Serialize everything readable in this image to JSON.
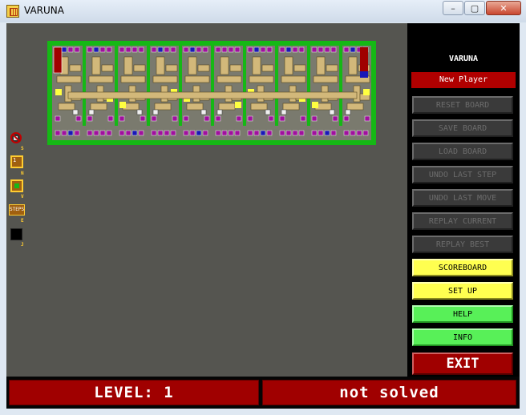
{
  "window": {
    "title": "VARUNA",
    "minimize": "–",
    "maximize": "▢",
    "close": "✕"
  },
  "side_keys": {
    "sound": "S",
    "number": "N",
    "view": "V",
    "steps": "E",
    "steps_label": "STEPS",
    "jump": "J",
    "number_label": "1"
  },
  "panel": {
    "title": "VARUNA",
    "player": "New Player",
    "buttons": [
      {
        "label": "RESET BOARD",
        "style": "disabled"
      },
      {
        "label": "SAVE BOARD",
        "style": "disabled"
      },
      {
        "label": "LOAD BOARD",
        "style": "disabled"
      },
      {
        "label": "UNDO LAST STEP",
        "style": "disabled"
      },
      {
        "label": "UNDO LAST MOVE",
        "style": "disabled"
      },
      {
        "label": "REPLAY CURRENT",
        "style": "disabled"
      },
      {
        "label": "REPLAY BEST",
        "style": "disabled"
      },
      {
        "label": "SCOREBOARD",
        "style": "yellow"
      },
      {
        "label": "SET UP",
        "style": "yellow"
      },
      {
        "label": "HELP",
        "style": "green"
      },
      {
        "label": "INFO",
        "style": "green"
      }
    ],
    "exit": "EXIT"
  },
  "status": {
    "level": "LEVEL: 1",
    "state": "not solved"
  },
  "colors": {
    "board_green": "#15b815",
    "floor": "#7a7a6e",
    "wall_tan": "#d2b87a",
    "target_purple": "#a0109e",
    "box_blue": "#1818b8",
    "yellow_tile": "#ffff40",
    "red_door": "#a00000"
  }
}
